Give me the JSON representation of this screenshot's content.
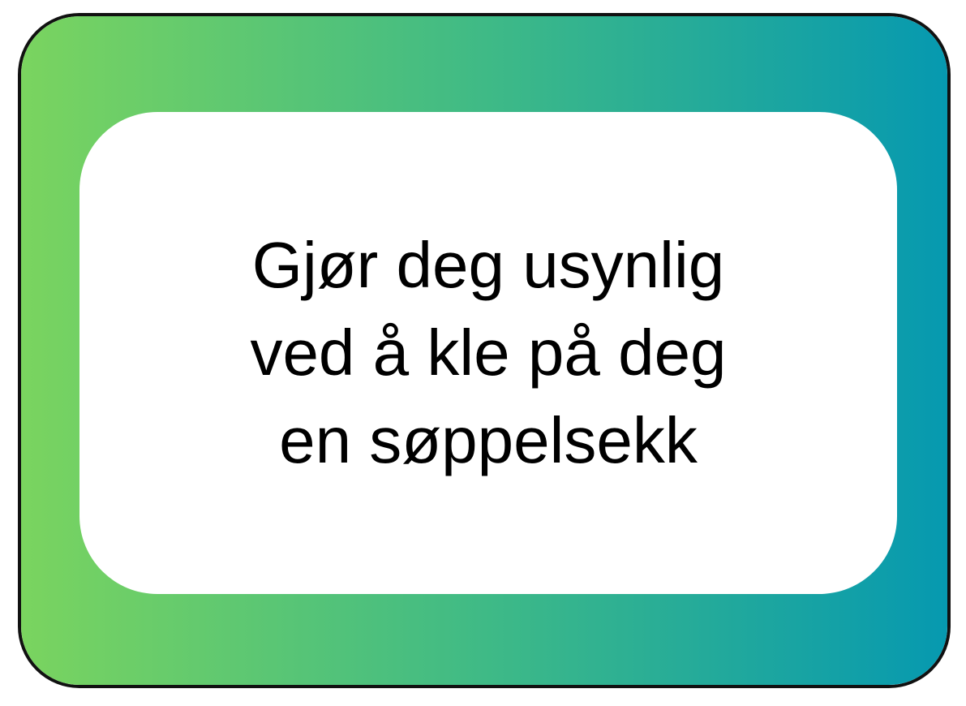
{
  "card": {
    "lines": [
      "Gjør deg usynlig",
      "ved å kle på deg",
      "en søppelsekk"
    ],
    "colors": {
      "gradient_start": "#7ad45f",
      "gradient_mid": "#3fba86",
      "gradient_end": "#0699b0",
      "border": "#111111",
      "panel": "#ffffff",
      "text": "#000000"
    }
  }
}
